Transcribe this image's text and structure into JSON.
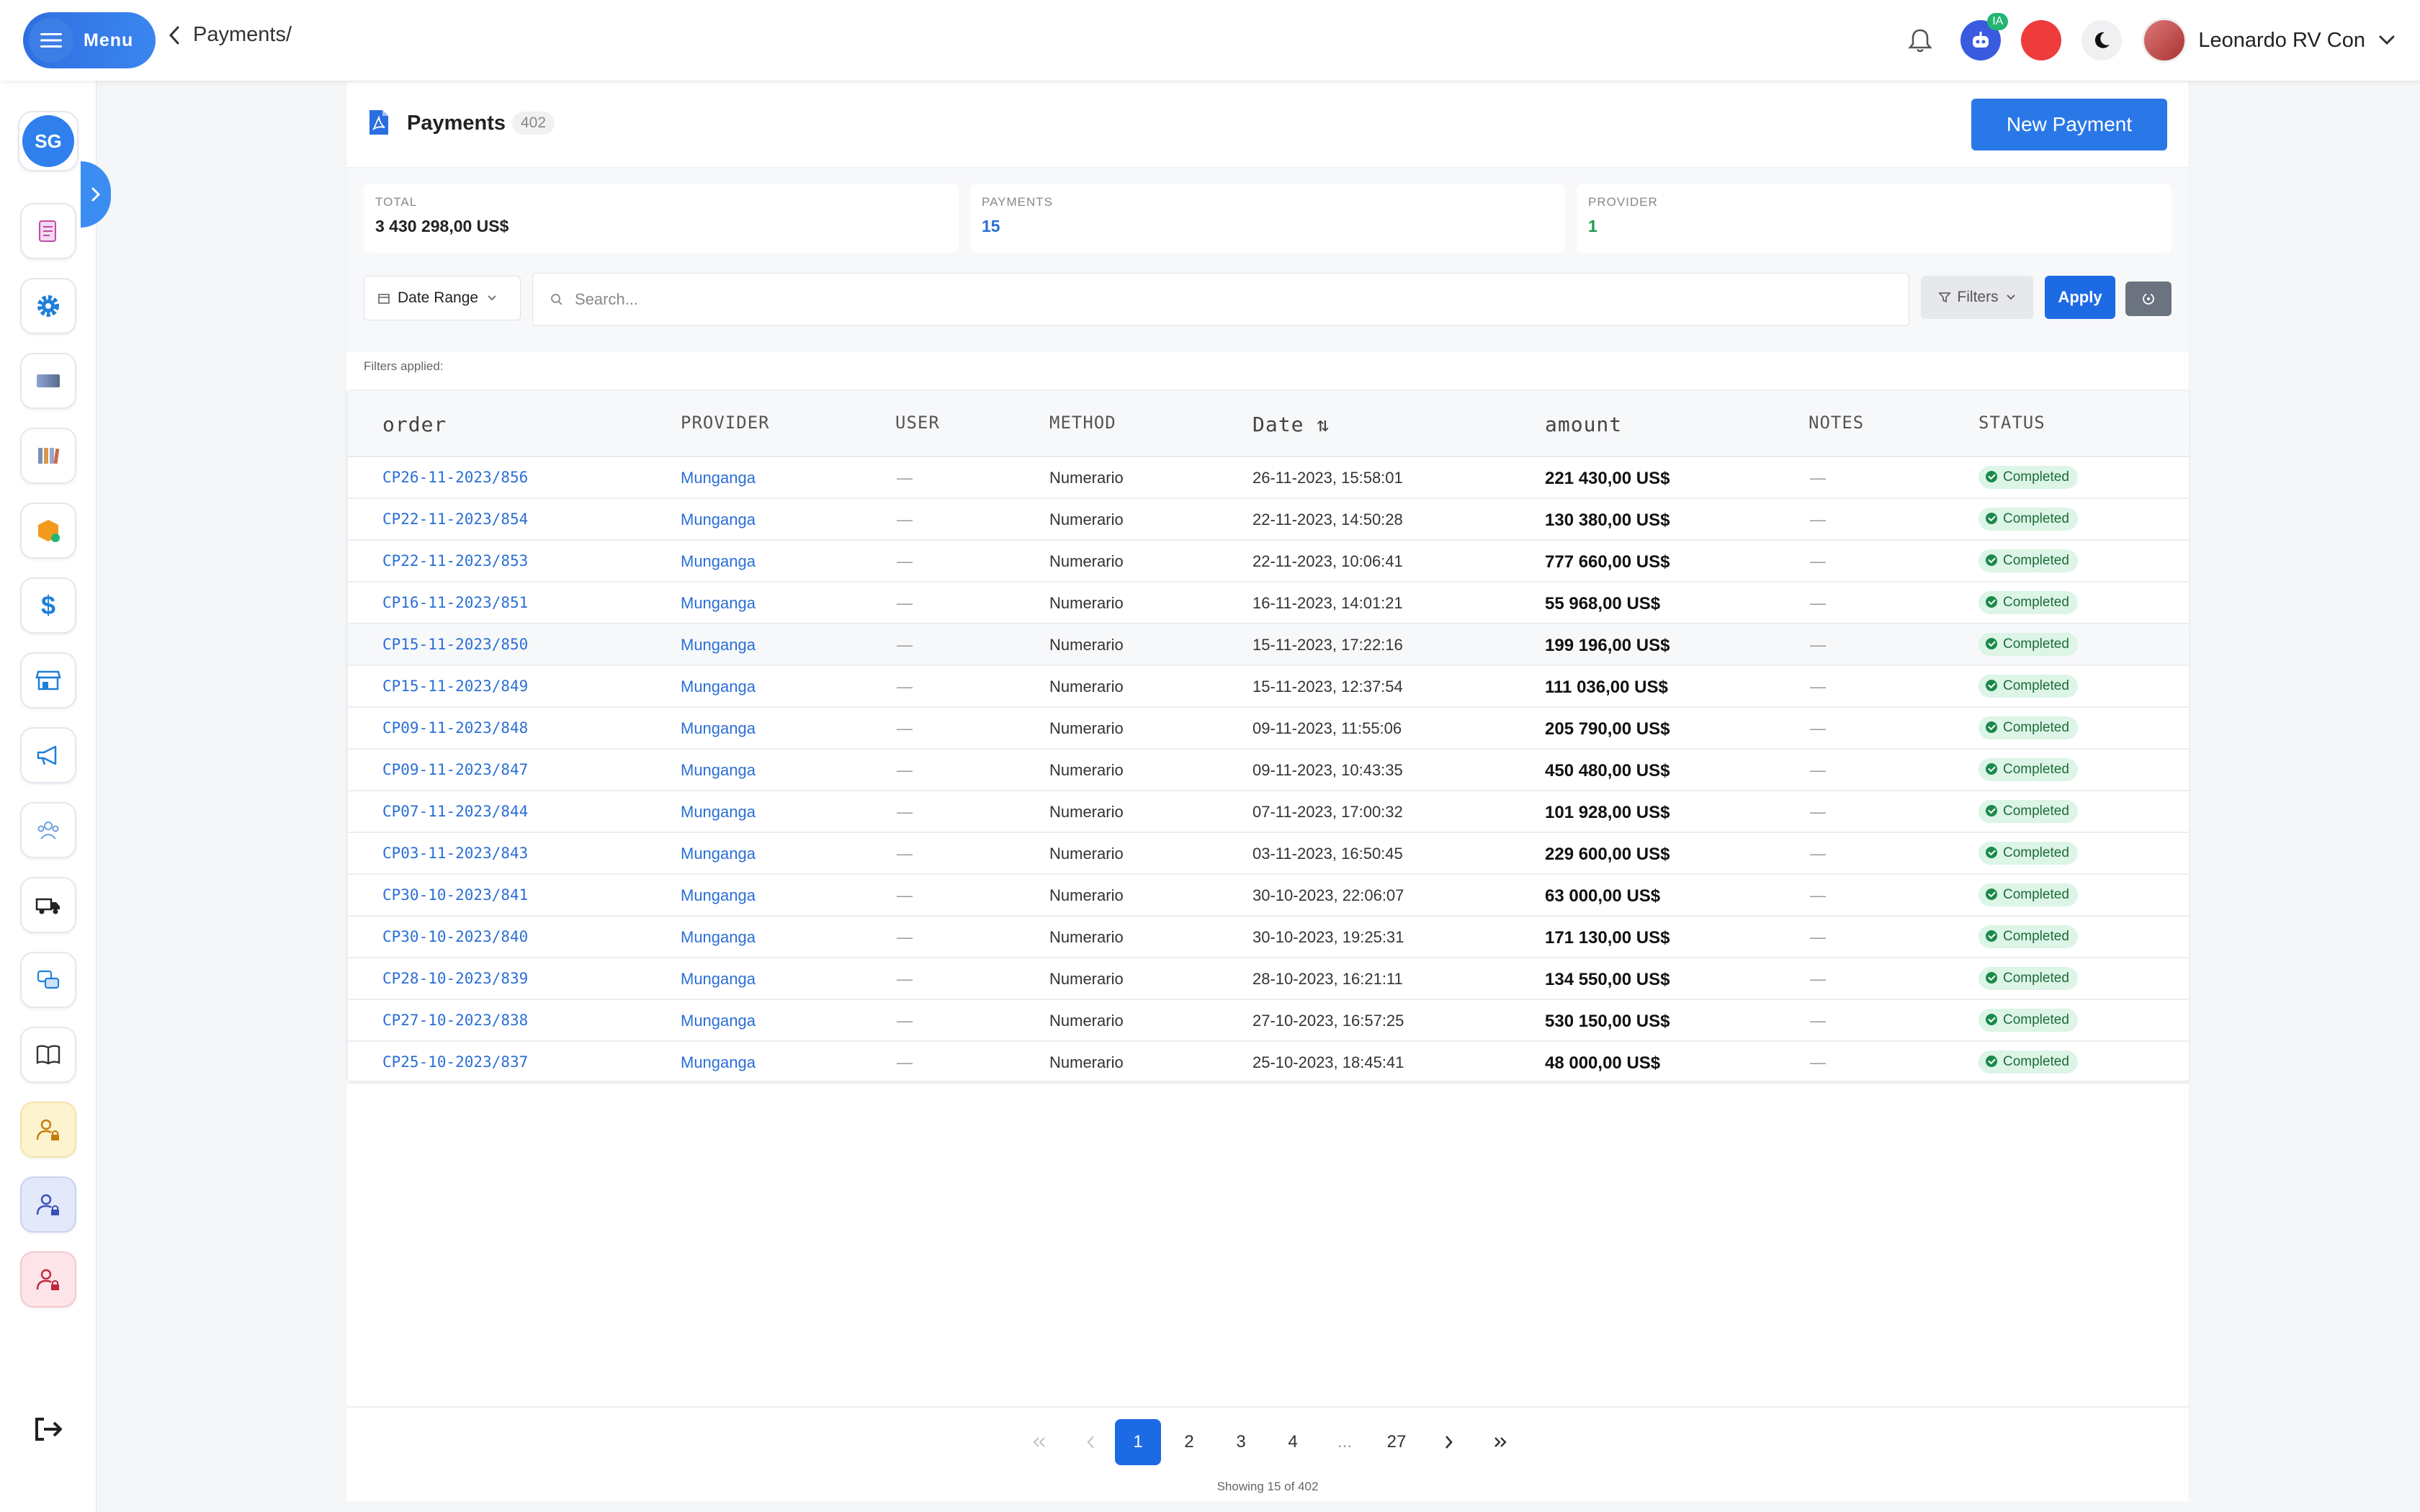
{
  "topbar": {
    "menu_label": "Menu",
    "breadcrumb": "Payments/",
    "ia_badge": "IA",
    "user_name": "Leonardo RV Con"
  },
  "sidebar": {
    "workspace_initials": "SG",
    "icons": [
      "scroll-icon",
      "gear-icon",
      "card-icon",
      "books-icon",
      "box-icon",
      "dollar-icon",
      "store-icon",
      "megaphone-icon",
      "team-icon",
      "truck-icon",
      "chat-icon",
      "book-icon",
      "user-lock-icon",
      "user-lock-icon",
      "user-lock-icon"
    ]
  },
  "header": {
    "title": "Payments",
    "count": "402",
    "new_button": "New Payment"
  },
  "stats": [
    {
      "label": "TOTAL",
      "value": "3 430 298,00 US$",
      "color": "#222222"
    },
    {
      "label": "PAYMENTS",
      "value": "15",
      "color": "#2a6fd6"
    },
    {
      "label": "PROVIDER",
      "value": "1",
      "color": "#1a9a52"
    }
  ],
  "filters": {
    "date_range": "Date Range",
    "search_placeholder": "Search...",
    "filters_label": "Filters",
    "apply_label": "Apply",
    "applied_label": "Filters applied:"
  },
  "table": {
    "columns": [
      "order",
      "PROVIDER",
      "USER",
      "METHOD",
      "Date ⇅",
      "amount",
      "NOTES",
      "STATUS"
    ],
    "rows": [
      {
        "order": "CP26-11-2023/856",
        "provider": "Munganga",
        "user": "—",
        "method": "Numerario",
        "date": "26-11-2023, 15:58:01",
        "amount": "221 430,00 US$",
        "notes": "—",
        "status": "Completed"
      },
      {
        "order": "CP22-11-2023/854",
        "provider": "Munganga",
        "user": "—",
        "method": "Numerario",
        "date": "22-11-2023, 14:50:28",
        "amount": "130 380,00 US$",
        "notes": "—",
        "status": "Completed"
      },
      {
        "order": "CP22-11-2023/853",
        "provider": "Munganga",
        "user": "—",
        "method": "Numerario",
        "date": "22-11-2023, 10:06:41",
        "amount": "777 660,00 US$",
        "notes": "—",
        "status": "Completed"
      },
      {
        "order": "CP16-11-2023/851",
        "provider": "Munganga",
        "user": "—",
        "method": "Numerario",
        "date": "16-11-2023, 14:01:21",
        "amount": "55 968,00 US$",
        "notes": "—",
        "status": "Completed"
      },
      {
        "order": "CP15-11-2023/850",
        "provider": "Munganga",
        "user": "—",
        "method": "Numerario",
        "date": "15-11-2023, 17:22:16",
        "amount": "199 196,00 US$",
        "notes": "—",
        "status": "Completed"
      },
      {
        "order": "CP15-11-2023/849",
        "provider": "Munganga",
        "user": "—",
        "method": "Numerario",
        "date": "15-11-2023, 12:37:54",
        "amount": "111 036,00 US$",
        "notes": "—",
        "status": "Completed"
      },
      {
        "order": "CP09-11-2023/848",
        "provider": "Munganga",
        "user": "—",
        "method": "Numerario",
        "date": "09-11-2023, 11:55:06",
        "amount": "205 790,00 US$",
        "notes": "—",
        "status": "Completed"
      },
      {
        "order": "CP09-11-2023/847",
        "provider": "Munganga",
        "user": "—",
        "method": "Numerario",
        "date": "09-11-2023, 10:43:35",
        "amount": "450 480,00 US$",
        "notes": "—",
        "status": "Completed"
      },
      {
        "order": "CP07-11-2023/844",
        "provider": "Munganga",
        "user": "—",
        "method": "Numerario",
        "date": "07-11-2023, 17:00:32",
        "amount": "101 928,00 US$",
        "notes": "—",
        "status": "Completed"
      },
      {
        "order": "CP03-11-2023/843",
        "provider": "Munganga",
        "user": "—",
        "method": "Numerario",
        "date": "03-11-2023, 16:50:45",
        "amount": "229 600,00 US$",
        "notes": "—",
        "status": "Completed"
      },
      {
        "order": "CP30-10-2023/841",
        "provider": "Munganga",
        "user": "—",
        "method": "Numerario",
        "date": "30-10-2023, 22:06:07",
        "amount": "63 000,00 US$",
        "notes": "—",
        "status": "Completed"
      },
      {
        "order": "CP30-10-2023/840",
        "provider": "Munganga",
        "user": "—",
        "method": "Numerario",
        "date": "30-10-2023, 19:25:31",
        "amount": "171 130,00 US$",
        "notes": "—",
        "status": "Completed"
      },
      {
        "order": "CP28-10-2023/839",
        "provider": "Munganga",
        "user": "—",
        "method": "Numerario",
        "date": "28-10-2023, 16:21:11",
        "amount": "134 550,00 US$",
        "notes": "—",
        "status": "Completed"
      },
      {
        "order": "CP27-10-2023/838",
        "provider": "Munganga",
        "user": "—",
        "method": "Numerario",
        "date": "27-10-2023, 16:57:25",
        "amount": "530 150,00 US$",
        "notes": "—",
        "status": "Completed"
      },
      {
        "order": "CP25-10-2023/837",
        "provider": "Munganga",
        "user": "—",
        "method": "Numerario",
        "date": "25-10-2023, 18:45:41",
        "amount": "48 000,00 US$",
        "notes": "—",
        "status": "Completed"
      }
    ]
  },
  "pagination": {
    "pages": [
      "1",
      "2",
      "3",
      "4",
      "...",
      "27"
    ],
    "current": "1",
    "showing": "Showing 15 of 402"
  }
}
